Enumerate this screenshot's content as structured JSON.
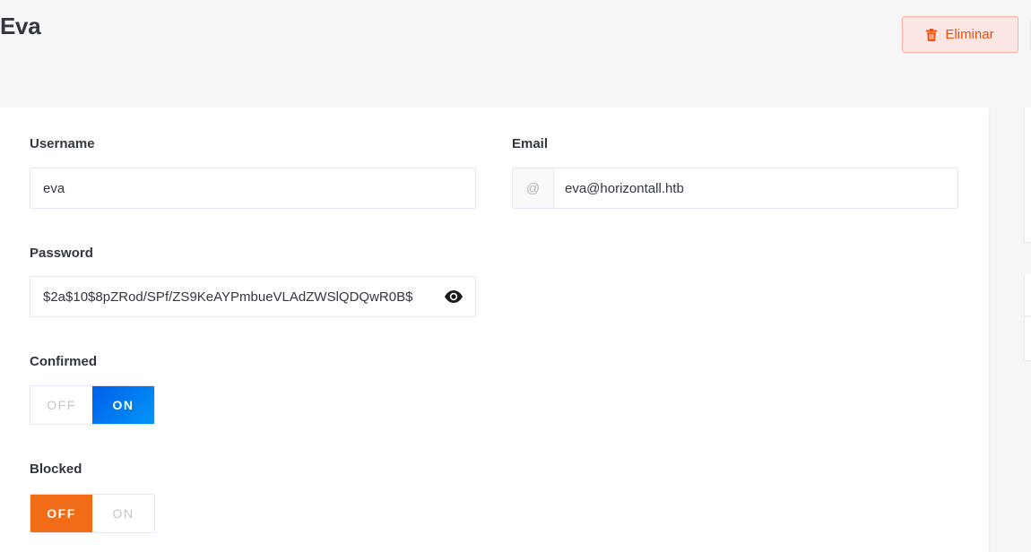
{
  "header": {
    "title": "Eva",
    "delete_label": "Eliminar"
  },
  "form": {
    "username": {
      "label": "Username",
      "value": "eva"
    },
    "email": {
      "label": "Email",
      "prefix": "@",
      "value": "eva@horizontall.htb"
    },
    "password": {
      "label": "Password",
      "value": "$2a$10$8pZRod/SPf/ZS9KeAYPmbueVLAdZWSlQDQwR0B$"
    },
    "confirmed": {
      "label": "Confirmed",
      "off_label": "OFF",
      "on_label": "ON",
      "value": "ON"
    },
    "blocked": {
      "label": "Blocked",
      "off_label": "OFF",
      "on_label": "ON",
      "value": "OFF"
    }
  },
  "icons": {
    "delete": "trash-icon",
    "password_toggle": "eye-icon"
  },
  "colors": {
    "danger": "#f64d0a",
    "on_active": "#007eff",
    "off_active": "#f26b17"
  }
}
